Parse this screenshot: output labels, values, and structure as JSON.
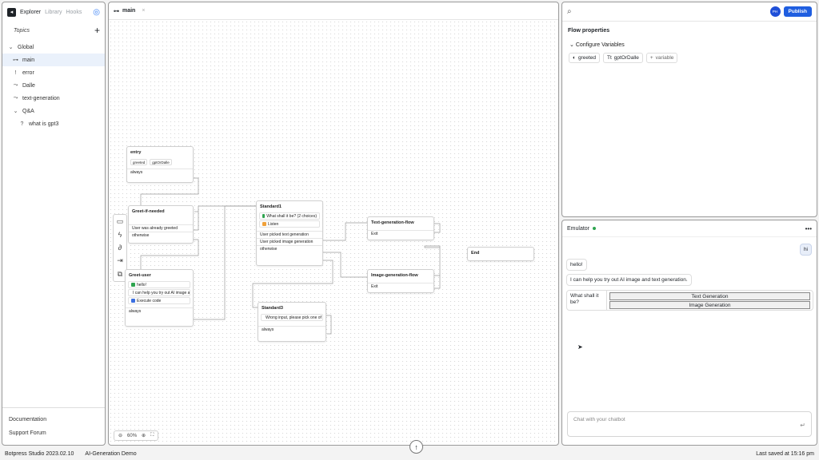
{
  "sidebar": {
    "tabs": [
      "Explorer",
      "Library",
      "Hooks"
    ],
    "topics_label": "Topics",
    "tree": [
      {
        "label": "Global",
        "icon": "chevron-down-icon",
        "level": 0
      },
      {
        "label": "main",
        "icon": "flow-icon",
        "level": 1,
        "active": true
      },
      {
        "label": "error",
        "icon": "warning-icon",
        "level": 1
      },
      {
        "label": "Dalle",
        "icon": "workflow-icon",
        "level": 1
      },
      {
        "label": "text-generation",
        "icon": "workflow-icon",
        "level": 1
      },
      {
        "label": "Q&A",
        "icon": "chevron-down-icon",
        "level": 1
      },
      {
        "label": "what is gpt3",
        "icon": "question-icon",
        "level": 2
      }
    ],
    "footer": [
      "Documentation",
      "Support Forum"
    ]
  },
  "canvas": {
    "tab": "main",
    "zoom": "60%",
    "nodes": {
      "entry": {
        "title": "entry",
        "chips": [
          "greeted",
          "gptOrDalle"
        ],
        "rows": [
          "always"
        ]
      },
      "greet_if_needed": {
        "title": "Greet-if-needed",
        "rows": [
          "User was already greeted",
          "otherwise"
        ]
      },
      "greet_user": {
        "title": "Greet-user",
        "cards": [
          "hello!",
          "I can help you try out AI image and ...",
          "Execute code"
        ],
        "rows": [
          "always"
        ]
      },
      "standard1": {
        "title": "Standard1",
        "cards": [
          "What shall it be? (2 choices)",
          "Listen"
        ],
        "rows": [
          "User picked text generation",
          "User picked image generation",
          "otherwise"
        ]
      },
      "standard3": {
        "title": "Standard3",
        "cards": [
          "Wrong input, please pick one of th..."
        ],
        "rows": [
          "always"
        ]
      },
      "text_flow": {
        "title": "Text-generation-flow",
        "rows": [
          "Exit"
        ]
      },
      "image_flow": {
        "title": "Image-generation-flow",
        "rows": [
          "Exit"
        ]
      },
      "end": {
        "title": "End"
      }
    }
  },
  "properties": {
    "search_placeholder": "",
    "avatar": "PH",
    "publish_label": "Publish",
    "title": "Flow properties",
    "configure_label": "Configure Variables",
    "variables": [
      "greeted",
      "gptOrDalle"
    ],
    "add_variable": "variable"
  },
  "emulator": {
    "title": "Emulator",
    "messages": {
      "user_hi": "hi",
      "bot_hello": "hello!",
      "bot_help": "I can help you try out AI image and text generation.",
      "question": "What shall it be?",
      "choices": [
        "Text Generation",
        "Image Generation"
      ]
    },
    "input_placeholder": "Chat with your chatbot"
  },
  "status": {
    "version": "Botpress Studio 2023.02.10",
    "project": "AI-Generation Demo",
    "saved": "Last saved at 15:16 pm"
  }
}
